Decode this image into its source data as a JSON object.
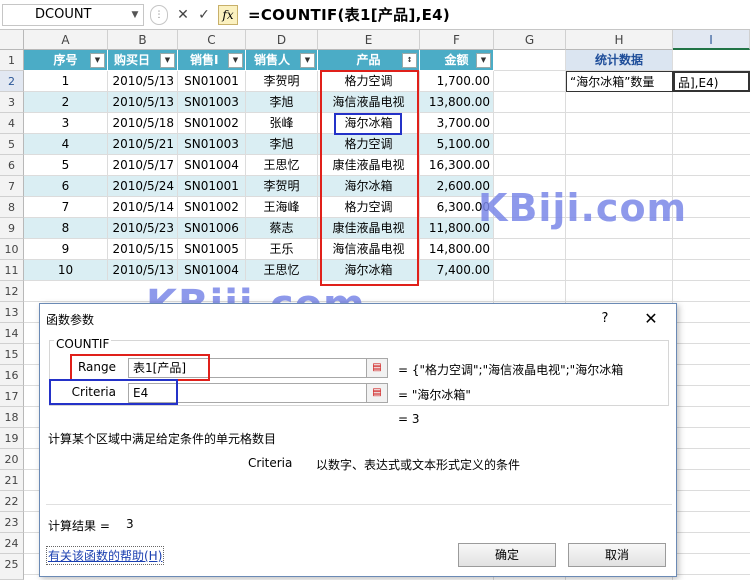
{
  "formula_bar": {
    "name_box": "DCOUNT",
    "cancel_icon": "✕",
    "enter_icon": "✓",
    "fx_label": "fx",
    "formula": "=COUNTIF(表1[产品],E4)"
  },
  "columns": [
    "A",
    "B",
    "C",
    "D",
    "E",
    "F",
    "G",
    "H",
    "I"
  ],
  "rows": [
    "1",
    "2",
    "3",
    "4",
    "5",
    "6",
    "7",
    "8",
    "9",
    "10",
    "11",
    "12",
    "13",
    "14",
    "15",
    "16",
    "17",
    "18",
    "19",
    "20",
    "21",
    "22",
    "23",
    "24",
    "25"
  ],
  "table": {
    "headers": [
      "序号",
      "购买日",
      "销售I",
      "销售人",
      "产品",
      "金额"
    ],
    "rows": [
      [
        "1",
        "2010/5/13",
        "SN01001",
        "李贺明",
        "格力空调",
        "1,700.00"
      ],
      [
        "2",
        "2010/5/13",
        "SN01003",
        "李旭",
        "海信液晶电视",
        "13,800.00"
      ],
      [
        "3",
        "2010/5/18",
        "SN01002",
        "张峰",
        "海尔冰箱",
        "3,700.00"
      ],
      [
        "4",
        "2010/5/21",
        "SN01003",
        "李旭",
        "格力空调",
        "5,100.00"
      ],
      [
        "5",
        "2010/5/17",
        "SN01004",
        "王思忆",
        "康佳液晶电视",
        "16,300.00"
      ],
      [
        "6",
        "2010/5/24",
        "SN01001",
        "李贺明",
        "海尔冰箱",
        "2,600.00"
      ],
      [
        "7",
        "2010/5/14",
        "SN01002",
        "王海峰",
        "格力空调",
        "6,300.00"
      ],
      [
        "8",
        "2010/5/23",
        "SN01006",
        "蔡志",
        "康佳液晶电视",
        "11,800.00"
      ],
      [
        "9",
        "2010/5/15",
        "SN01005",
        "王乐",
        "海信液晶电视",
        "14,800.00"
      ],
      [
        "10",
        "2010/5/13",
        "SN01004",
        "王思忆",
        "海尔冰箱",
        "7,400.00"
      ]
    ]
  },
  "stats": {
    "header": "统计数据",
    "label": "“海尔冰箱”数量",
    "edit_value": "品],E4)"
  },
  "watermark": "KBiji.com",
  "dialog": {
    "title": "函数参数",
    "help_icon": "?",
    "close_icon": "✕",
    "function_name": "COUNTIF",
    "args": [
      {
        "label": "Range",
        "value": "表1[产品]",
        "result": "= {\"格力空调\";\"海信液晶电视\";\"海尔冰箱"
      },
      {
        "label": "Criteria",
        "value": "E4",
        "result": "= \"海尔冰箱\""
      }
    ],
    "function_result": "= 3",
    "description": "计算某个区域中满足给定条件的单元格数目",
    "arg_help_name": "Criteria",
    "arg_help_text": "以数字、表达式或文本形式定义的条件",
    "calc_result_label": "计算结果 =",
    "calc_result_value": "3",
    "help_link": "有关该函数的帮助(H)",
    "ok_label": "确定",
    "cancel_label": "取消"
  },
  "colors": {
    "table_header": "#4bacc6",
    "band": "#daeef3",
    "annotation_red": "#e0201a",
    "annotation_blue": "#2432c8",
    "watermark": "#7b88e8"
  }
}
